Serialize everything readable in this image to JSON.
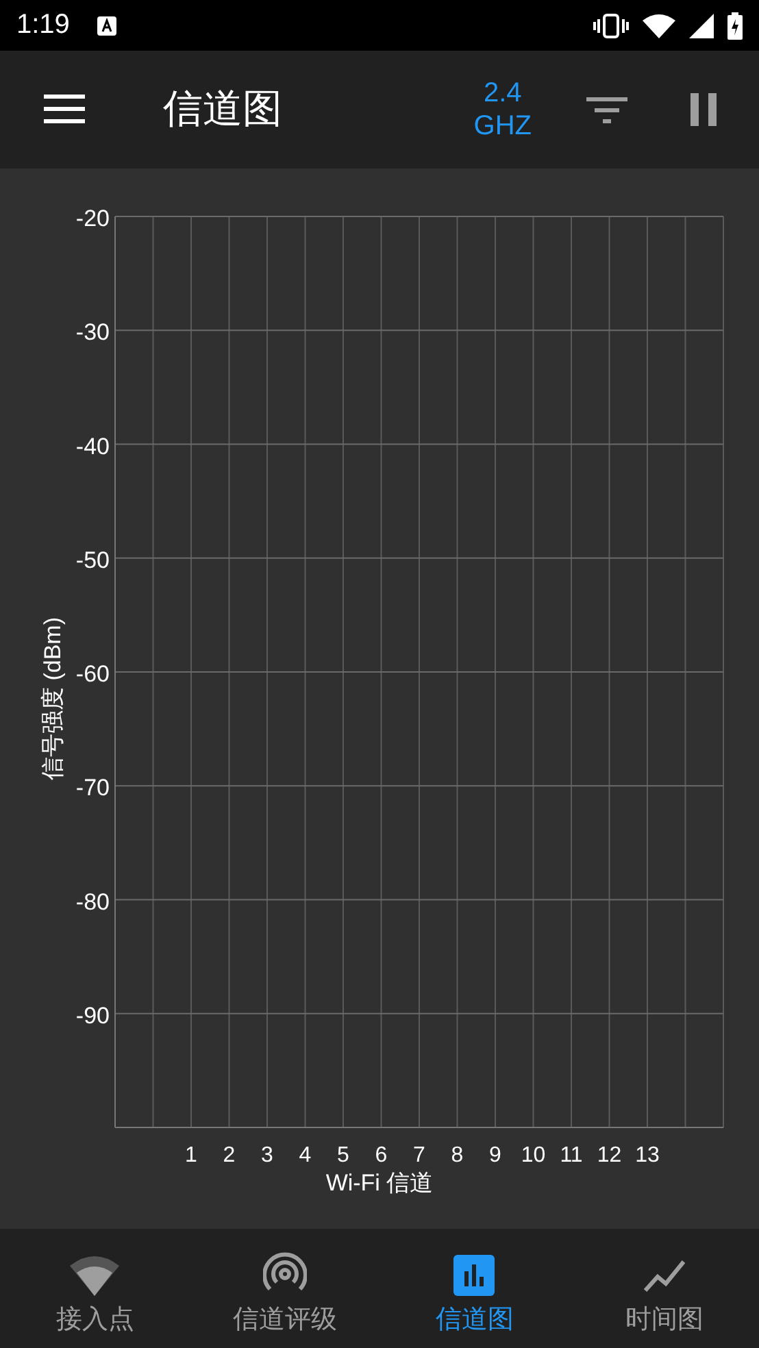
{
  "status_bar": {
    "time": "1:19"
  },
  "app_bar": {
    "title": "信道图",
    "band": [
      "2.4",
      "GHZ"
    ]
  },
  "chart": {
    "chart_data": {
      "type": "line",
      "grid": true,
      "xlabel": "Wi-Fi 信道",
      "ylabel": "信号强度 (dBm)",
      "xlim": [
        -1,
        15
      ],
      "ylim": [
        -100,
        -20
      ],
      "xticks": [
        1,
        2,
        3,
        4,
        5,
        6,
        7,
        8,
        9,
        10,
        11,
        12,
        13
      ],
      "yticks": [
        -20,
        -30,
        -40,
        -50,
        -60,
        -70,
        -80,
        -90
      ]
    }
  },
  "bottom_nav": [
    {
      "label": "接入点",
      "selected": false
    },
    {
      "label": "信道评级",
      "selected": false
    },
    {
      "label": "信道图",
      "selected": true
    },
    {
      "label": "时间图",
      "selected": false
    }
  ]
}
